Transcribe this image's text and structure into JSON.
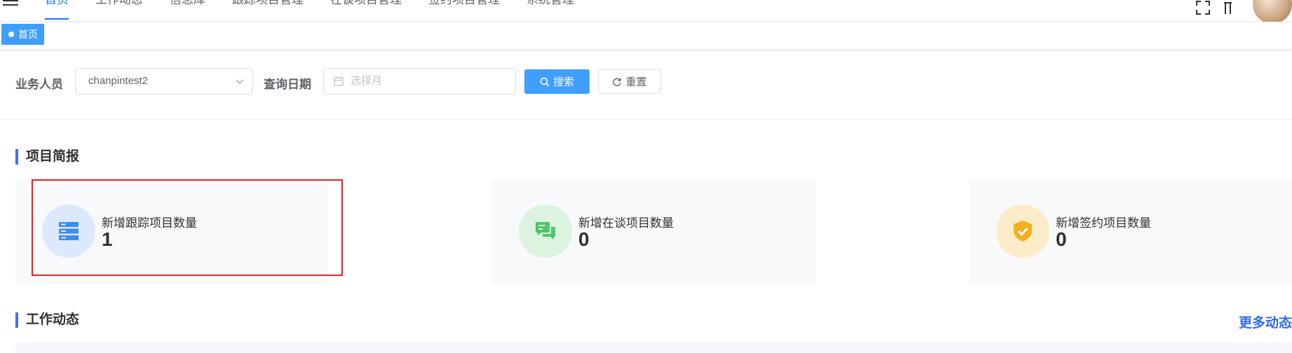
{
  "nav": {
    "items": [
      {
        "label": "首页",
        "active": true
      },
      {
        "label": "工作动态",
        "active": false
      },
      {
        "label": "信息库",
        "active": false
      },
      {
        "label": "跟踪项目管理",
        "active": false
      },
      {
        "label": "在谈项目管理",
        "active": false
      },
      {
        "label": "签约项目管理",
        "active": false
      },
      {
        "label": "系统管理",
        "active": false
      }
    ]
  },
  "tags": {
    "current": "首页"
  },
  "filter": {
    "staff_label": "业务人员",
    "staff_value": "chanpintest2",
    "date_label": "查询日期",
    "date_placeholder": "选择月",
    "search_label": "搜索",
    "reset_label": "重置"
  },
  "brief": {
    "title": "项目简报",
    "cards": [
      {
        "label": "新增跟踪项目数量",
        "value": "1",
        "icon": "server-stack-icon",
        "circle_color": "#dce8fb",
        "icon_color": "#3f8cf0"
      },
      {
        "label": "新增在谈项目数量",
        "value": "0",
        "icon": "chat-bubbles-icon",
        "circle_color": "#dcf3df",
        "icon_color": "#4cc76a"
      },
      {
        "label": "新增签约项目数量",
        "value": "0",
        "icon": "shield-check-icon",
        "circle_color": "#fbebc9",
        "icon_color": "#f4b021"
      }
    ]
  },
  "activity": {
    "title": "工作动态",
    "more_label": "更多动态"
  },
  "colors": {
    "primary": "#409eff",
    "accent_bar": "#4a6cf7",
    "highlight": "#e0242a"
  }
}
